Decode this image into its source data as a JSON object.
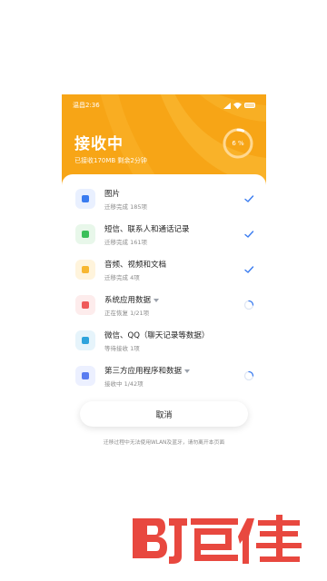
{
  "status_bar": {
    "time": "温昌2:36"
  },
  "hero": {
    "title": "接收中",
    "subtitle": "已接收170MB 剩余2分钟",
    "progress_label": "6 %",
    "progress": 0.06,
    "accent_color": "#f7a516"
  },
  "items": [
    {
      "icon": "photos-icon",
      "icon_bg": "#e9f0ff",
      "icon_fg": "#3a7cf0",
      "title": "图片",
      "has_caret": false,
      "status": "迁移完成 185项",
      "state": "done"
    },
    {
      "icon": "messages-icon",
      "icon_bg": "#e8f7ea",
      "icon_fg": "#3bbf5a",
      "title": "短信、联系人和通话记录",
      "has_caret": false,
      "status": "迁移完成 161项",
      "state": "done"
    },
    {
      "icon": "folder-icon",
      "icon_bg": "#fff4dc",
      "icon_fg": "#f7b731",
      "title": "音频、视频和文档",
      "has_caret": false,
      "status": "迁移完成 4项",
      "state": "done"
    },
    {
      "icon": "system-apps-icon",
      "icon_bg": "#fdecec",
      "icon_fg": "#ef5a5a",
      "title": "系统应用数据",
      "has_caret": true,
      "status": "正在恢复 1/21项",
      "state": "loading"
    },
    {
      "icon": "chat-icon",
      "icon_bg": "#e6f4fb",
      "icon_fg": "#2fa3dc",
      "title": "微信、QQ（聊天记录等数据）",
      "has_caret": false,
      "status": "等待接收 1项",
      "state": "none"
    },
    {
      "icon": "document-icon",
      "icon_bg": "#ecf0ff",
      "icon_fg": "#5a7cf0",
      "title": "第三方应用程序和数据",
      "has_caret": true,
      "status": "接收中 1/42项",
      "state": "loading"
    }
  ],
  "cancel_label": "取消",
  "footer_note": "迁移过程中无法使用WLAN及蓝牙，请勿离开本页面",
  "watermark_text": "百佳",
  "watermark_color": "#e8483f"
}
